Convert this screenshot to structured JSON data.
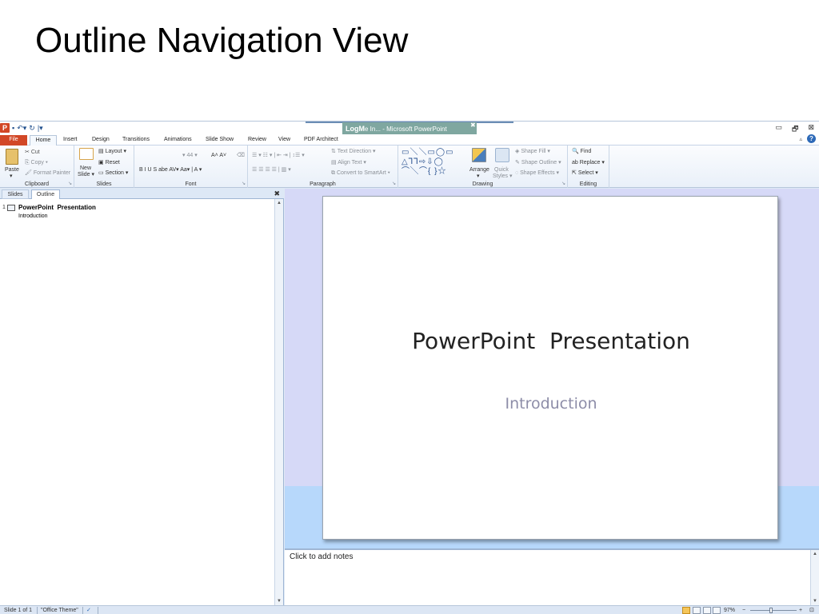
{
  "page_heading": "Outline Navigation View",
  "titlebar": {
    "app_icon": "P",
    "qat_items": [
      "save-icon",
      "undo-icon",
      "redo-icon",
      "customize-icon"
    ],
    "qat_glyphs": [
      "▪",
      "↶▾",
      "↻",
      "|▾"
    ],
    "tooltip_bold": "LogM",
    "tooltip_rest": "e In... - Microsoft PowerPoint",
    "tooltip_close": "✖",
    "window_controls": [
      "▭",
      "🗗",
      "⊠"
    ]
  },
  "tabs": {
    "file": "File",
    "home": "Home",
    "others": [
      "Insert",
      "Design",
      "Transitions",
      "Animations",
      "Slide Show",
      "Review",
      "View",
      "PDF Architect"
    ],
    "help_caret": "▵",
    "help": "?"
  },
  "ribbon": {
    "clipboard": {
      "paste": "Paste",
      "paste_caret": "▾",
      "cut": "Cut",
      "copy": "Copy ▾",
      "format_painter": "Format Painter",
      "label": "Clipboard"
    },
    "slides": {
      "new_slide_1": "New",
      "new_slide_2": "Slide ▾",
      "layout": "Layout ▾",
      "reset": "Reset",
      "section": "Section ▾",
      "label": "Slides"
    },
    "font": {
      "size": "▾  44  ▾",
      "grow": "A˄ A˅",
      "clear": "⌫",
      "styles": "B  I  U  S  abe  AV▾  Aa▾  |  A ▾",
      "label": "Font"
    },
    "paragraph": {
      "row1": "☰ ▾  ☷ ▾  |  ⇤ ⇥  |  ↕☰ ▾",
      "row2": "☰  ☰  ☰  ☰  |  ▥ ▾",
      "text_direction": "Text Direction ▾",
      "align_text": "Align Text ▾",
      "convert_smartart": "Convert to SmartArt ▾",
      "label": "Paragraph"
    },
    "drawing": {
      "shapes": "▭＼＼▭◯▭\n△⅂⅂⇨⇩◯\n⌒╲⌒{ }☆",
      "arrange": "Arrange",
      "arrange_caret": "▾",
      "quick_styles_1": "Quick",
      "quick_styles_2": "Styles ▾",
      "shape_fill": "Shape Fill ▾",
      "shape_outline": "Shape Outline ▾",
      "shape_effects": "Shape Effects ▾",
      "label": "Drawing"
    },
    "editing": {
      "find": "Find",
      "replace": "Replace ▾",
      "select": "Select ▾",
      "label": "Editing"
    }
  },
  "left_pane": {
    "tab_slides": "Slides",
    "tab_outline": "Outline",
    "close": "✖",
    "outline": [
      {
        "num": "1",
        "title": "PowerPoint  Presentation",
        "sub": "Introduction"
      }
    ]
  },
  "slide": {
    "title": "PowerPoint  Presentation",
    "subtitle": "Introduction"
  },
  "notes": {
    "placeholder": "Click to add notes"
  },
  "statusbar": {
    "slide_count": "Slide 1 of 1",
    "theme": "\"Office Theme\"",
    "spell_icon": "✓",
    "zoom": "97%",
    "zoom_minus": "−",
    "zoom_plus": "+",
    "fit": "⊡"
  },
  "colors": {
    "file_tab": "#d24726",
    "slide_area": "#d6d9f7",
    "slide_area_band": "#b7d8fb"
  }
}
